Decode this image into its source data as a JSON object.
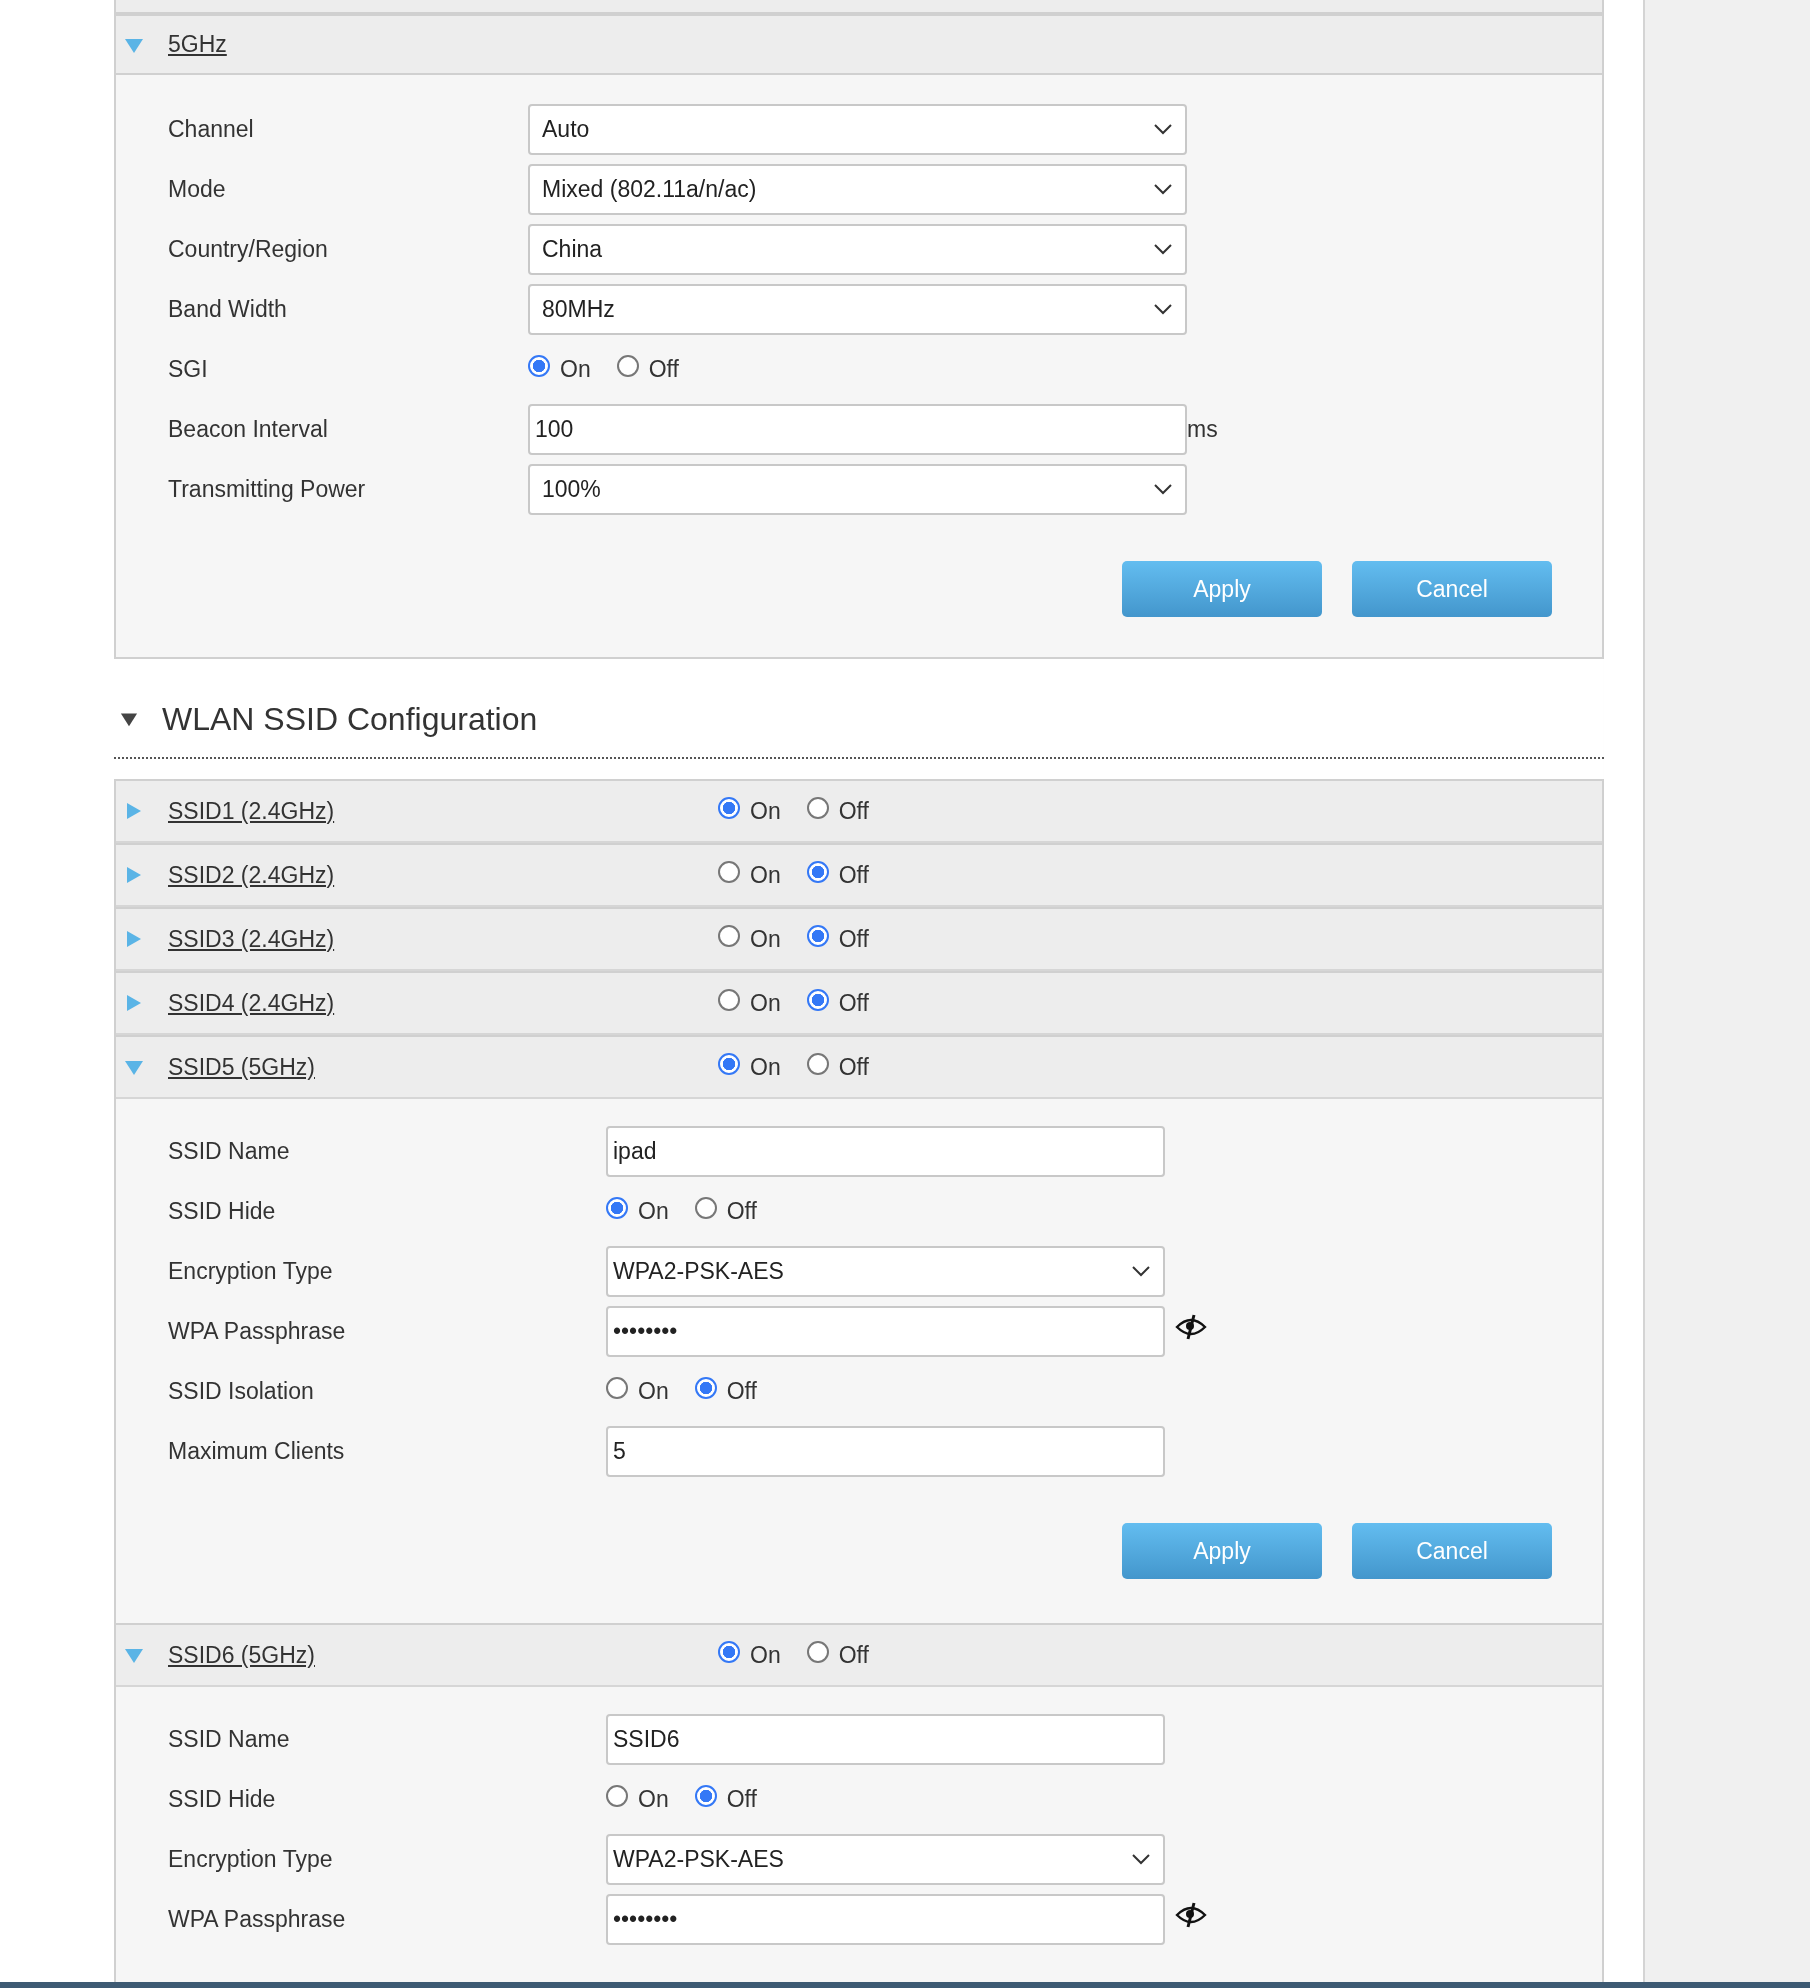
{
  "band_section": {
    "title": "5GHz",
    "expanded": true,
    "fields": [
      {
        "kind": "select",
        "label": "Channel",
        "value": "Auto"
      },
      {
        "kind": "select",
        "label": "Mode",
        "value": "Mixed (802.11a/n/ac)"
      },
      {
        "kind": "select",
        "label": "Country/Region",
        "value": "China"
      },
      {
        "kind": "select",
        "label": "Band Width",
        "value": "80MHz"
      },
      {
        "kind": "radio",
        "label": "SGI",
        "options": [
          {
            "label": "On",
            "selected": true
          },
          {
            "label": "Off",
            "selected": false
          }
        ]
      },
      {
        "kind": "text",
        "label": "Beacon Interval",
        "value": "100",
        "unit": "ms"
      },
      {
        "kind": "select",
        "label": "Transmitting Power",
        "value": "100%"
      }
    ],
    "buttons": [
      "Apply",
      "Cancel"
    ]
  },
  "ssid_section": {
    "title": "WLAN SSID Configuration",
    "expanded": true,
    "ssids": [
      {
        "title": "SSID1 (2.4GHz)",
        "expanded": false,
        "options": [
          {
            "label": "On",
            "selected": true
          },
          {
            "label": "Off",
            "selected": false
          }
        ]
      },
      {
        "title": "SSID2 (2.4GHz)",
        "expanded": false,
        "options": [
          {
            "label": "On",
            "selected": false
          },
          {
            "label": "Off",
            "selected": true
          }
        ]
      },
      {
        "title": "SSID3 (2.4GHz)",
        "expanded": false,
        "options": [
          {
            "label": "On",
            "selected": false
          },
          {
            "label": "Off",
            "selected": true
          }
        ]
      },
      {
        "title": "SSID4 (2.4GHz)",
        "expanded": false,
        "options": [
          {
            "label": "On",
            "selected": false
          },
          {
            "label": "Off",
            "selected": true
          }
        ]
      },
      {
        "title": "SSID5 (5GHz)",
        "expanded": true,
        "options": [
          {
            "label": "On",
            "selected": true
          },
          {
            "label": "Off",
            "selected": false
          }
        ],
        "fields": [
          {
            "kind": "text",
            "label": "SSID Name",
            "value": "ipad"
          },
          {
            "kind": "radio",
            "label": "SSID Hide",
            "options": [
              {
                "label": "On",
                "selected": true
              },
              {
                "label": "Off",
                "selected": false
              }
            ]
          },
          {
            "kind": "select",
            "label": "Encryption Type",
            "value": "WPA2-PSK-AES"
          },
          {
            "kind": "password",
            "label": "WPA Passphrase",
            "value": "••••••••"
          },
          {
            "kind": "radio",
            "label": "SSID Isolation",
            "options": [
              {
                "label": "On",
                "selected": false
              },
              {
                "label": "Off",
                "selected": true
              }
            ]
          },
          {
            "kind": "text",
            "label": "Maximum Clients",
            "value": "5"
          }
        ],
        "buttons": [
          "Apply",
          "Cancel"
        ]
      },
      {
        "title": "SSID6 (5GHz)",
        "expanded": true,
        "options": [
          {
            "label": "On",
            "selected": true
          },
          {
            "label": "Off",
            "selected": false
          }
        ],
        "fields": [
          {
            "kind": "text",
            "label": "SSID Name",
            "value": "SSID6"
          },
          {
            "kind": "radio",
            "label": "SSID Hide",
            "options": [
              {
                "label": "On",
                "selected": false
              },
              {
                "label": "Off",
                "selected": true
              }
            ]
          },
          {
            "kind": "select",
            "label": "Encryption Type",
            "value": "WPA2-PSK-AES"
          },
          {
            "kind": "password",
            "label": "WPA Passphrase",
            "value": "••••••••"
          }
        ]
      }
    ]
  }
}
